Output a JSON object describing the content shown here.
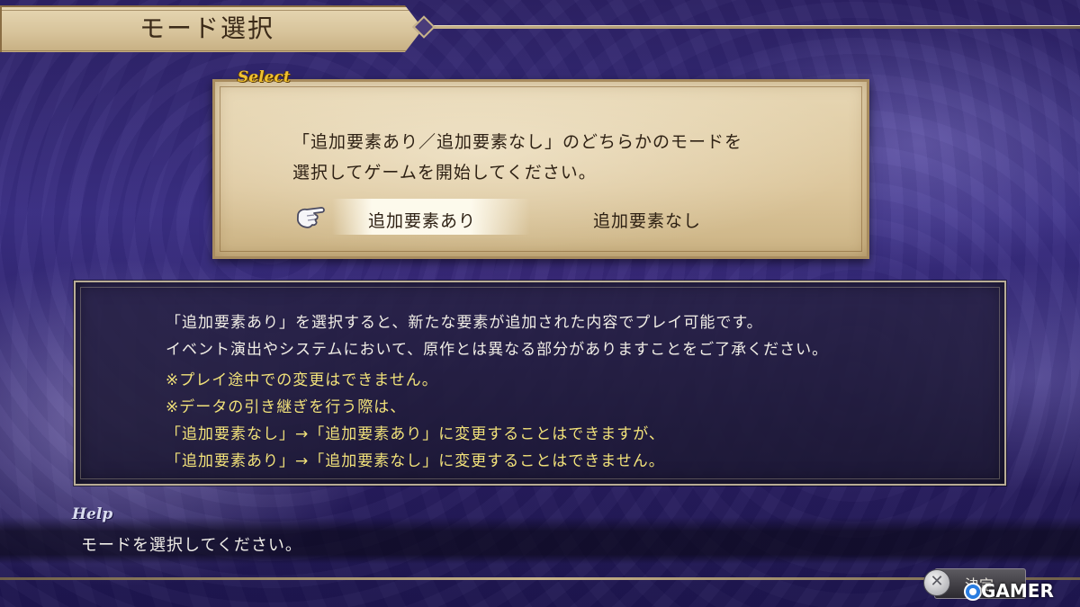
{
  "screen": {
    "title": "モード選択"
  },
  "select_panel": {
    "tag": "Select",
    "instruction_line1": "「追加要素あり／追加要素なし」のどちらかのモードを",
    "instruction_line2": "選択してゲームを開始してください。",
    "options": [
      {
        "label": "追加要素あり",
        "selected": true
      },
      {
        "label": "追加要素なし",
        "selected": false
      }
    ]
  },
  "info_panel": {
    "lines": [
      {
        "text": "「追加要素あり」を選択すると、新たな要素が追加された内容でプレイ可能です。",
        "color": "white"
      },
      {
        "text": "イベント演出やシステムにおいて、原作とは異なる部分がありますことをご了承ください。",
        "color": "white"
      },
      {
        "text": "※プレイ途中での変更はできません。",
        "color": "yellow"
      },
      {
        "text": "※データの引き継ぎを行う際は、",
        "color": "yellow"
      },
      {
        "text": "「追加要素なし」→「追加要素あり」に変更することはできますが、",
        "color": "yellow"
      },
      {
        "text": "「追加要素あり」→「追加要素なし」に変更することはできません。",
        "color": "yellow"
      }
    ]
  },
  "help": {
    "tag": "Help",
    "text": "モードを選択してください。"
  },
  "footer": {
    "confirm_button_glyph": "✕",
    "confirm_label": "決定",
    "watermark": "GAMER"
  },
  "colors": {
    "parchment": "#dcc69c",
    "select_tag": "#f0c030",
    "info_white": "#f1eee6",
    "info_yellow": "#f2e27a",
    "background_purple": "#3b2f86"
  },
  "icons": {
    "cursor": "pointing-hand-icon",
    "confirm": "cross-button-icon"
  }
}
